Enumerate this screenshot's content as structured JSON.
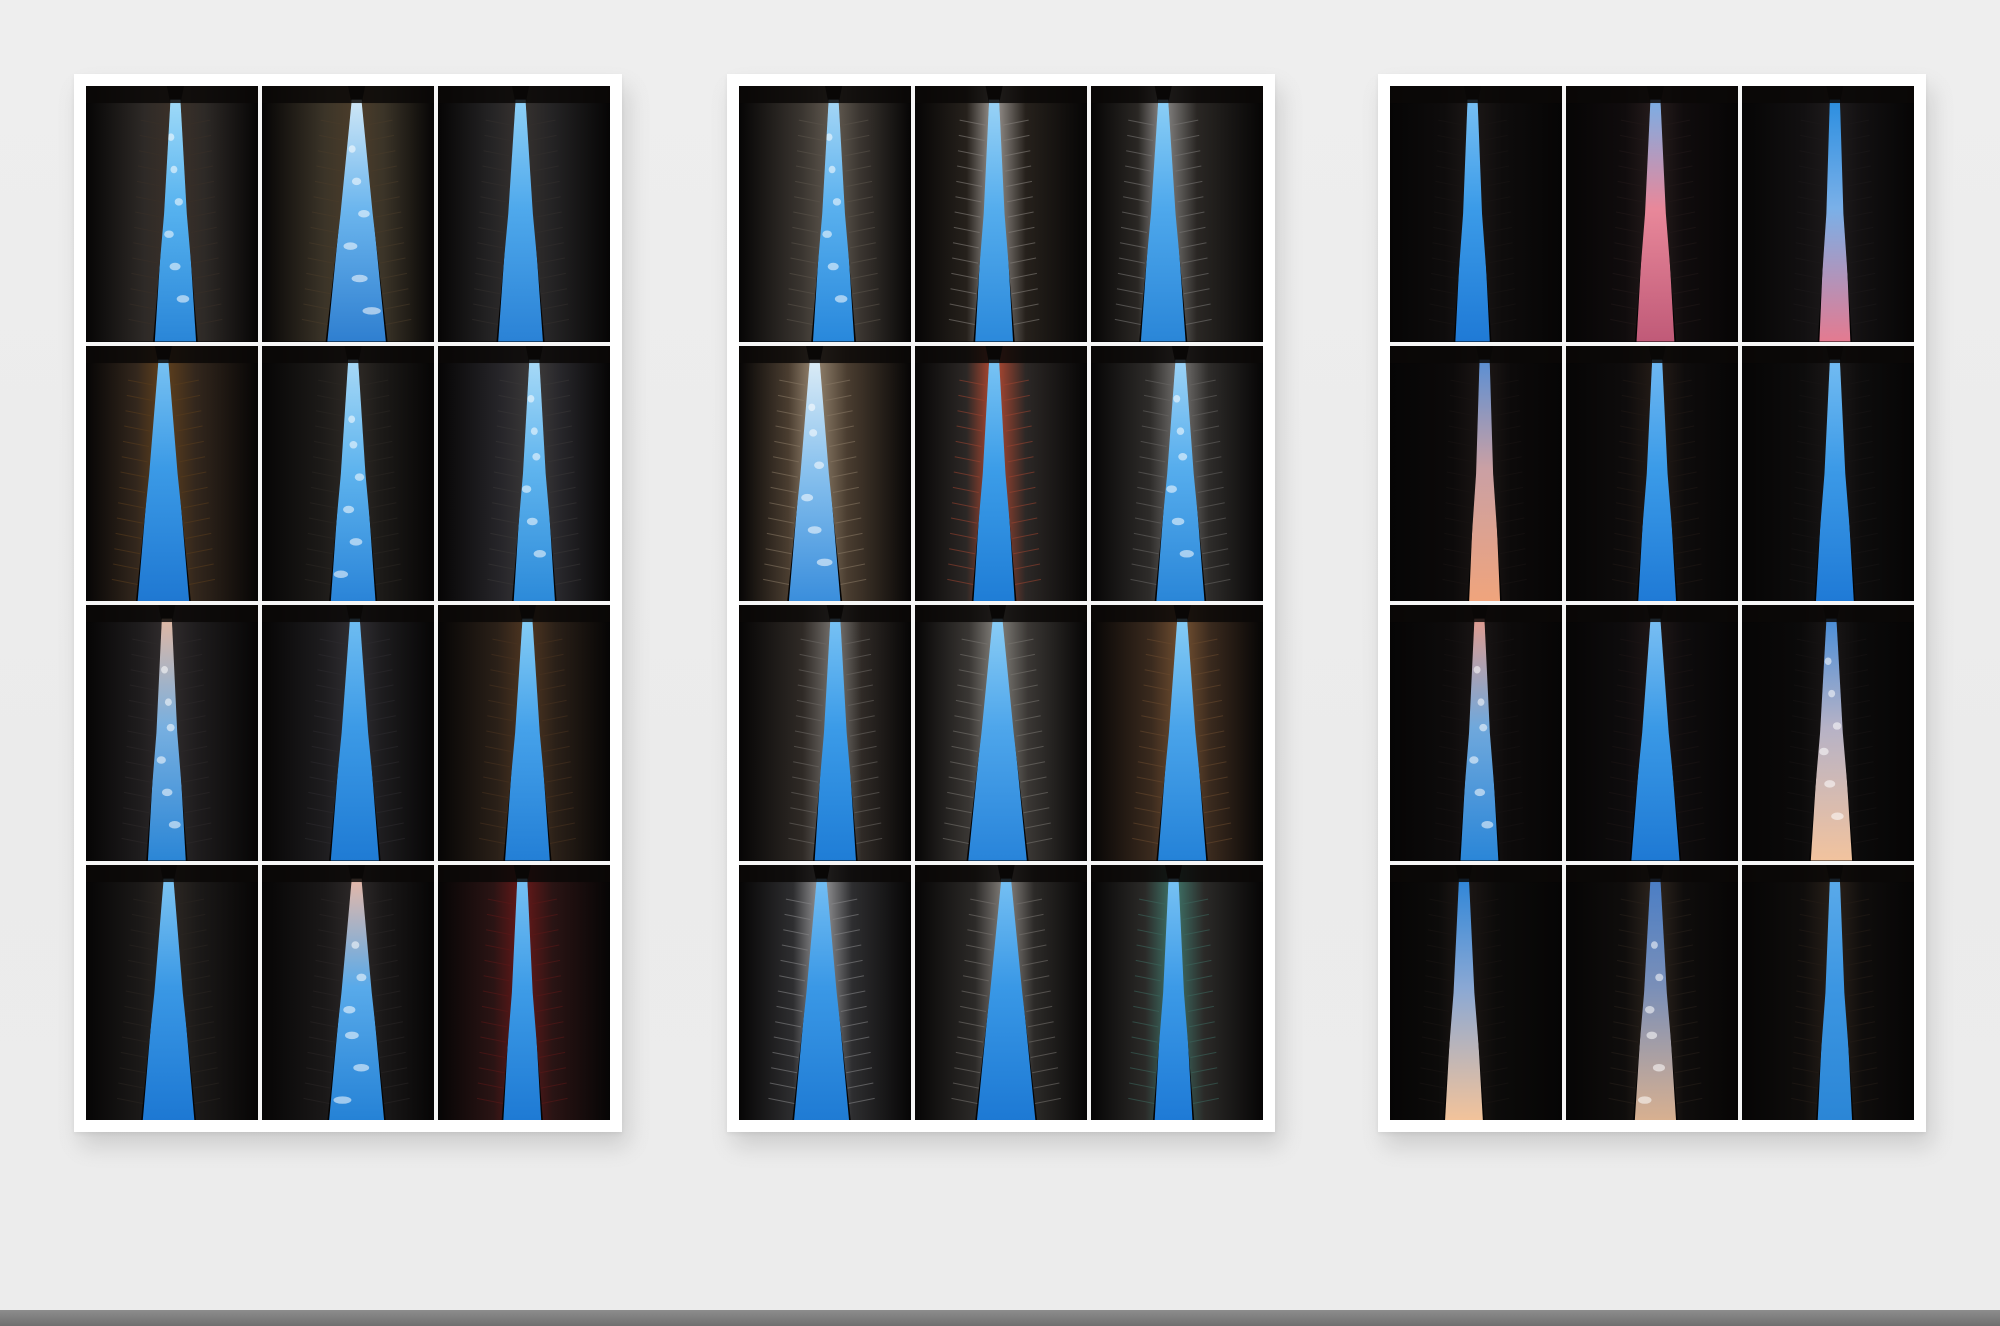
{
  "panels": [
    {
      "name": "panel-1",
      "tiles": [
        {
          "sky": [
            "#2a86d8",
            "#56b2ef",
            "#9fdaf8"
          ],
          "w": 0.24,
          "off": 0.02,
          "a": "#2e2a27",
          "b": "#3a3028",
          "clouds": true
        },
        {
          "sky": [
            "#2f7fd0",
            "#6cb6ee",
            "#cfe7f6"
          ],
          "w": 0.34,
          "off": 0.05,
          "a": "#3b3428",
          "b": "#4a3c2a",
          "clouds": true
        },
        {
          "sky": [
            "#2a82d6",
            "#4fa9ec",
            "#8fd0f6"
          ],
          "w": 0.26,
          "off": -0.02,
          "a": "#252425",
          "b": "#34302e",
          "clouds": false
        },
        {
          "sky": [
            "#1f78d2",
            "#3b9ae6",
            "#79c2f2"
          ],
          "w": 0.3,
          "off": -0.05,
          "a": "#33271d",
          "b": "#5a3d1d",
          "clouds": false
        },
        {
          "sky": [
            "#2a84d8",
            "#5fb4ee",
            "#a8d9f6"
          ],
          "w": 0.26,
          "off": 0.03,
          "a": "#1c1a18",
          "b": "#2c2824",
          "clouds": true
        },
        {
          "sky": [
            "#2c8ad9",
            "#5fb4ee",
            "#a8daf7"
          ],
          "w": 0.24,
          "off": 0.06,
          "a": "#27262a",
          "b": "#3a3838",
          "clouds": true
        },
        {
          "sky": [
            "#2b86d6",
            "#77afe0",
            "#e0b8a4"
          ],
          "w": 0.22,
          "off": -0.03,
          "a": "#1e1c1d",
          "b": "#2e2a2b",
          "clouds": true
        },
        {
          "sky": [
            "#1f7bd4",
            "#3c9ae6",
            "#6fbdf2"
          ],
          "w": 0.28,
          "off": 0.04,
          "a": "#1d1c1e",
          "b": "#2e2c30",
          "clouds": false
        },
        {
          "sky": [
            "#237fd6",
            "#46a2ea",
            "#86cdf5"
          ],
          "w": 0.26,
          "off": 0.02,
          "a": "#2a2018",
          "b": "#4a3320",
          "clouds": false
        },
        {
          "sky": [
            "#1d78d3",
            "#3a98e5",
            "#7dc4f2"
          ],
          "w": 0.3,
          "off": -0.02,
          "a": "#1b1918",
          "b": "#2b2622",
          "clouds": false
        },
        {
          "sky": [
            "#2582d6",
            "#58aaea",
            "#e6b8a8"
          ],
          "w": 0.32,
          "off": 0.05,
          "a": "#1a1818",
          "b": "#2b2727",
          "clouds": true
        },
        {
          "sky": [
            "#1e7ad4",
            "#3e9ce7",
            "#77c1f3"
          ],
          "w": 0.22,
          "off": -0.01,
          "a": "#2a1414",
          "b": "#5e1818",
          "clouds": false
        }
      ]
    },
    {
      "name": "panel-2",
      "tiles": [
        {
          "sky": [
            "#2888dc",
            "#59b0ee",
            "#a5d6f5"
          ],
          "w": 0.24,
          "off": 0.05,
          "a": "#3a3530",
          "b": "#5c554c",
          "clouds": true
        },
        {
          "sky": [
            "#2b89db",
            "#55aded",
            "#9ad3f6"
          ],
          "w": 0.22,
          "off": -0.04,
          "a": "#26211c",
          "b": "#8a8580",
          "clouds": false
        },
        {
          "sky": [
            "#2a86d8",
            "#4ea8ec",
            "#8ccff6"
          ],
          "w": 0.26,
          "off": -0.08,
          "a": "#2a2724",
          "b": "#7c7a78",
          "clouds": false
        },
        {
          "sky": [
            "#3a8edc",
            "#8ac2ee",
            "#dcecf6"
          ],
          "w": 0.3,
          "off": -0.06,
          "a": "#4a3d30",
          "b": "#8a7a66",
          "clouds": true
        },
        {
          "sky": [
            "#1f7dd6",
            "#3c9de8",
            "#7ac4f4"
          ],
          "w": 0.24,
          "off": -0.04,
          "a": "#2c2826",
          "b": "#a04430",
          "clouds": false
        },
        {
          "sky": [
            "#2a86d8",
            "#56aded",
            "#9dd3f6"
          ],
          "w": 0.28,
          "off": 0.02,
          "a": "#2e2c2a",
          "b": "#6a6866",
          "clouds": true
        },
        {
          "sky": [
            "#1f7dd6",
            "#3b9be8",
            "#78c2f4"
          ],
          "w": 0.24,
          "off": 0.06,
          "a": "#2f2a26",
          "b": "#6e6a66",
          "clouds": false
        },
        {
          "sky": [
            "#2884da",
            "#4ea6eb",
            "#8bcdf5"
          ],
          "w": 0.34,
          "off": -0.02,
          "a": "#3a3734",
          "b": "#7a7772",
          "clouds": false
        },
        {
          "sky": [
            "#2482d8",
            "#4aa4ea",
            "#86ccf5"
          ],
          "w": 0.28,
          "off": 0.03,
          "a": "#3a2a1e",
          "b": "#6a4a2e",
          "clouds": false
        },
        {
          "sky": [
            "#1f7bd4",
            "#3a98e6",
            "#74bef3"
          ],
          "w": 0.32,
          "off": -0.02,
          "a": "#2e2e30",
          "b": "#8a8a8c",
          "clouds": false
        },
        {
          "sky": [
            "#1d79d4",
            "#3998e6",
            "#76c0f3"
          ],
          "w": 0.34,
          "off": 0.03,
          "a": "#2c2a28",
          "b": "#7a7672",
          "clouds": false
        },
        {
          "sky": [
            "#1e7ad6",
            "#3c9ae7",
            "#78c2f4"
          ],
          "w": 0.22,
          "off": -0.02,
          "a": "#2b2a28",
          "b": "#3c6a60",
          "clouds": false
        }
      ]
    },
    {
      "name": "panel-3",
      "tiles": [
        {
          "sky": [
            "#1f7ad6",
            "#3b9be8",
            "#78c0f4"
          ],
          "w": 0.2,
          "off": -0.02,
          "a": "#0e0c0c",
          "b": "#1a1615",
          "clouds": false
        },
        {
          "sky": [
            "#c05a78",
            "#e8889a",
            "#7aaee6"
          ],
          "w": 0.22,
          "off": 0.02,
          "a": "#100c0d",
          "b": "#231a1a",
          "clouds": false
        },
        {
          "sky": [
            "#e47a90",
            "#7ab0e8",
            "#2b8ee0"
          ],
          "w": 0.18,
          "off": 0.04,
          "a": "#121011",
          "b": "#1d1a1b",
          "clouds": false
        },
        {
          "sky": [
            "#f0a47c",
            "#caa0a4",
            "#5a8fd4"
          ],
          "w": 0.18,
          "off": 0.05,
          "a": "#0c0a0a",
          "b": "#1a1514",
          "clouds": false
        },
        {
          "sky": [
            "#1f7ad6",
            "#3b9be8",
            "#6fb8f2"
          ],
          "w": 0.22,
          "off": 0.03,
          "a": "#0e0c0c",
          "b": "#221a16",
          "clouds": false
        },
        {
          "sky": [
            "#1f7ad6",
            "#3c9ae7",
            "#73bcf2"
          ],
          "w": 0.22,
          "off": 0.04,
          "a": "#0d0c0c",
          "b": "#191616",
          "clouds": false
        },
        {
          "sky": [
            "#2a86d8",
            "#6fa8dc",
            "#e09c90"
          ],
          "w": 0.22,
          "off": 0.02,
          "a": "#0d0b0b",
          "b": "#181414",
          "clouds": true
        },
        {
          "sky": [
            "#1e79d4",
            "#3a99e6",
            "#7abff3"
          ],
          "w": 0.28,
          "off": 0.02,
          "a": "#0e0c0d",
          "b": "#1e1616",
          "clouds": false
        },
        {
          "sky": [
            "#f2c39e",
            "#b6b2c6",
            "#4a8ed8"
          ],
          "w": 0.24,
          "off": 0.02,
          "a": "#0b0a0a",
          "b": "#181515",
          "clouds": true
        },
        {
          "sky": [
            "#f3c39a",
            "#8aa8d4",
            "#2f86d8"
          ],
          "w": 0.22,
          "off": -0.07,
          "a": "#0c0b0a",
          "b": "#1b1614",
          "clouds": false
        },
        {
          "sky": [
            "#d8b090",
            "#7a8fb8",
            "#4a7ec6"
          ],
          "w": 0.24,
          "off": 0.02,
          "a": "#0f0d0c",
          "b": "#2a221c",
          "clouds": true
        },
        {
          "sky": [
            "#2b86d6",
            "#3c96e2",
            "#5aaaea"
          ],
          "w": 0.2,
          "off": 0.04,
          "a": "#0f0d0c",
          "b": "#261e18",
          "clouds": false
        }
      ]
    }
  ]
}
